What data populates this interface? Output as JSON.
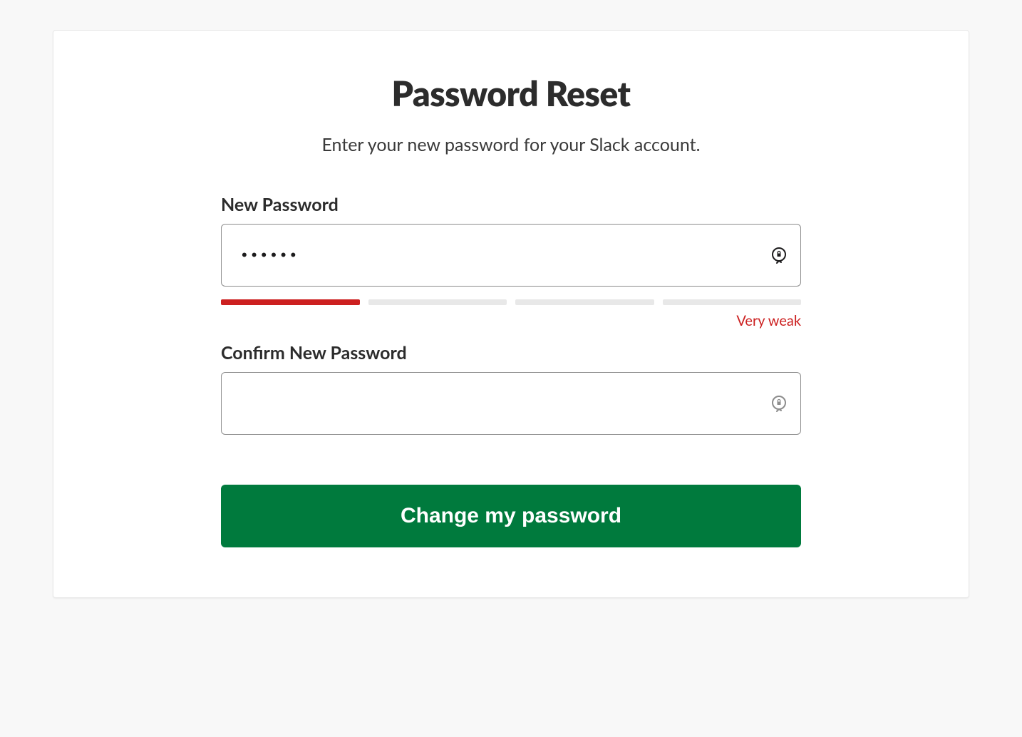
{
  "page": {
    "title": "Password Reset",
    "subtitle": "Enter your new password for your  Slack account."
  },
  "form": {
    "new_password": {
      "label": "New Password",
      "value": "••••••"
    },
    "confirm_password": {
      "label": "Confirm New Password",
      "value": ""
    },
    "strength": {
      "label": "Very weak",
      "level": 1,
      "color": "#cc2020"
    },
    "submit_label": "Change my password"
  },
  "icons": {
    "lock_active_color": "#1d1c1d",
    "lock_inactive_color": "#8c8c8c"
  }
}
